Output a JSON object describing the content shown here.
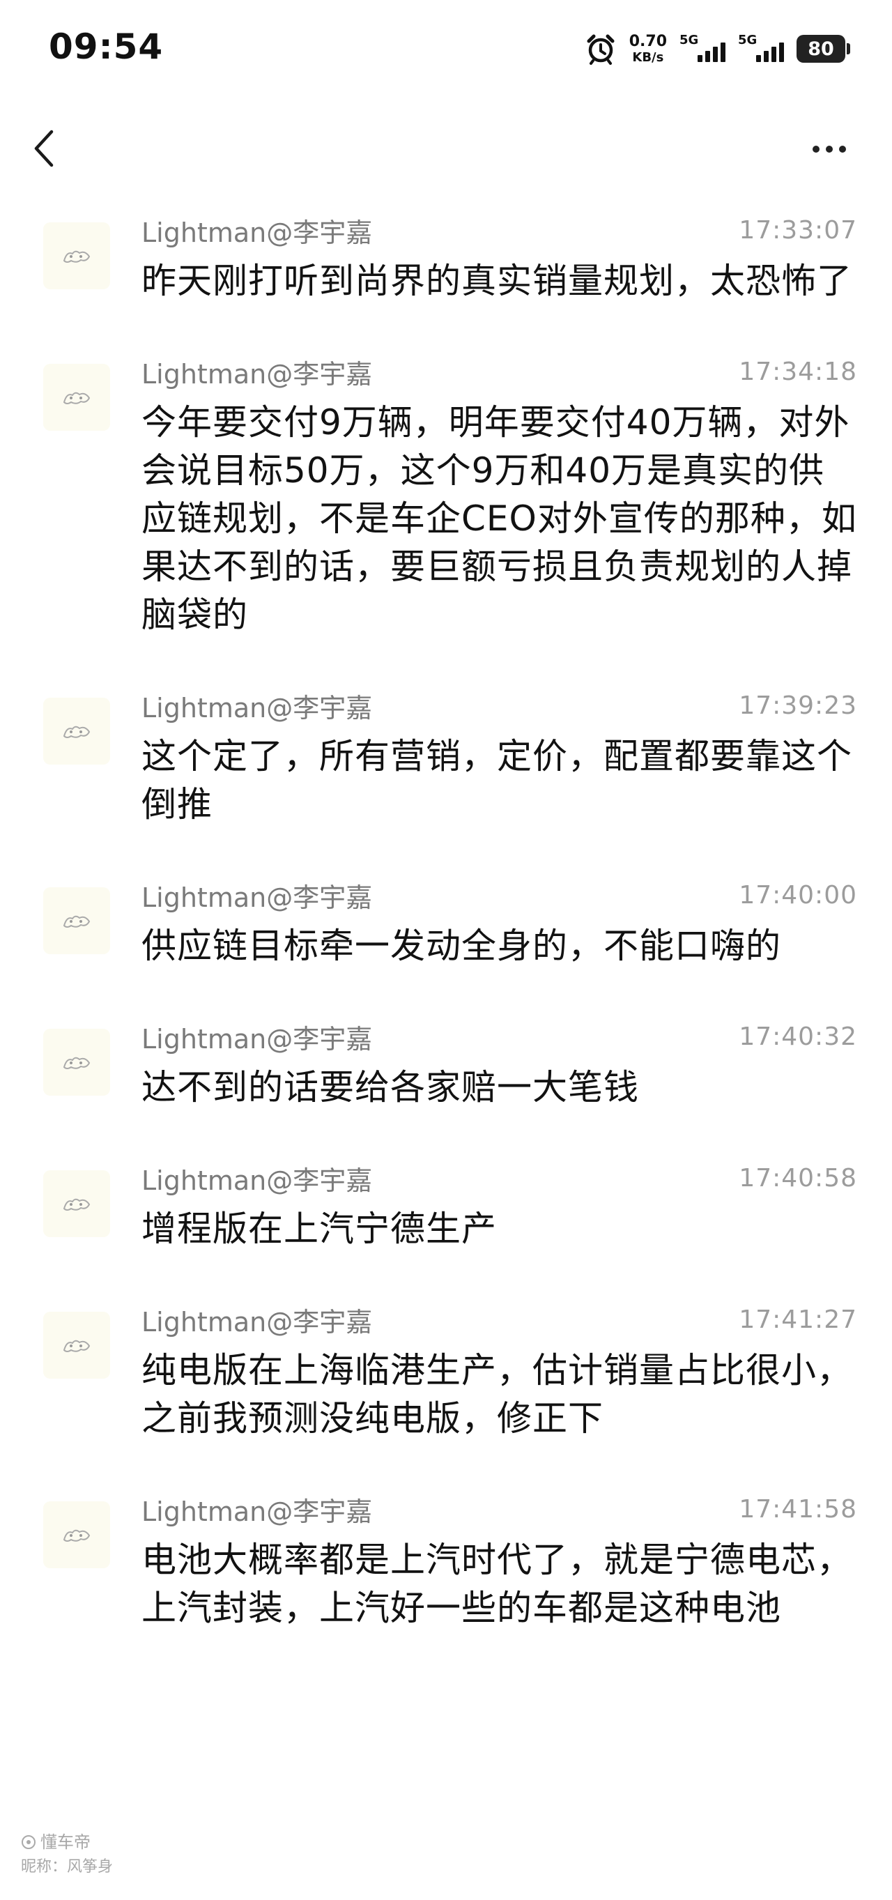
{
  "status_bar": {
    "time": "09:54",
    "net_speed_value": "0.70",
    "net_speed_unit": "KB/s",
    "sim1_label": "5G",
    "sim2_label": "5G",
    "battery": "80",
    "icons": [
      "alarm-icon",
      "signal-icon",
      "signal-icon",
      "battery-icon"
    ]
  },
  "nav": {
    "icons": [
      "back-arrow-icon",
      "more-dots-icon"
    ]
  },
  "messages": [
    {
      "sender": "Lightman@李宇嘉",
      "time": "17:33:07",
      "text": "昨天刚打听到尚界的真实销量规划，太恐怖了"
    },
    {
      "sender": "Lightman@李宇嘉",
      "time": "17:34:18",
      "text": "今年要交付9万辆，明年要交付40万辆，对外会说目标50万，这个9万和40万是真实的供应链规划，不是车企CEO对外宣传的那种，如果达不到的话，要巨额亏损且负责规划的人掉脑袋的"
    },
    {
      "sender": "Lightman@李宇嘉",
      "time": "17:39:23",
      "text": "这个定了，所有营销，定价，配置都要靠这个倒推"
    },
    {
      "sender": "Lightman@李宇嘉",
      "time": "17:40:00",
      "text": "供应链目标牵一发动全身的，不能口嗨的"
    },
    {
      "sender": "Lightman@李宇嘉",
      "time": "17:40:32",
      "text": "达不到的话要给各家赔一大笔钱"
    },
    {
      "sender": "Lightman@李宇嘉",
      "time": "17:40:58",
      "text": "增程版在上汽宁德生产"
    },
    {
      "sender": "Lightman@李宇嘉",
      "time": "17:41:27",
      "text": "纯电版在上海临港生产，估计销量占比很小，之前我预测没纯电版，修正下"
    },
    {
      "sender": "Lightman@李宇嘉",
      "time": "17:41:58",
      "text": "电池大概率都是上汽时代了，就是宁德电芯，上汽封装，上汽好一些的车都是这种电池"
    }
  ],
  "watermark": {
    "brand": "懂车帝",
    "nickname": "昵称：风筝身"
  }
}
